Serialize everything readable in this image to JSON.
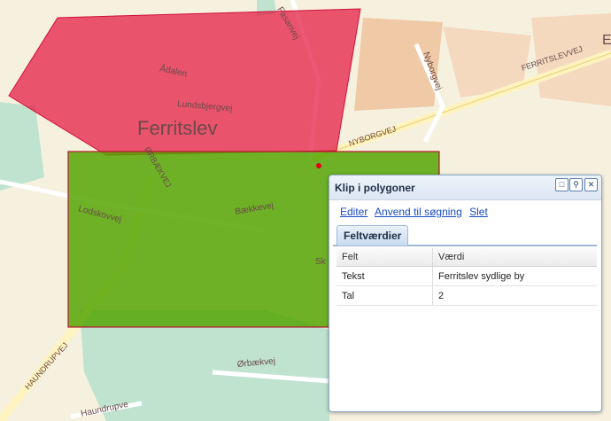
{
  "map": {
    "town_label": "Ferritslev",
    "corner_label": "E",
    "streets": [
      "Ådalen",
      "Lundsbjergvej",
      "Fasanvej",
      "Nyborgvej",
      "FERRITSLEVVEJ",
      "NYBORGVEJ",
      "ØRBÆKVEJ",
      "Lodskovvej",
      "Bækkevej",
      "Ørbækvej",
      "HAUNDRUPVEJ",
      "Haundrupve",
      "Sk"
    ],
    "colors": {
      "red_polygon": "#e3163f",
      "green_polygon": "#52a300",
      "land": "#f6f1df",
      "forest": "#bfe3cf",
      "road": "#fff4bf"
    }
  },
  "popup": {
    "title": "Klip i polygoner",
    "header_buttons": [
      "restore-icon",
      "magnifier-icon",
      "close-icon"
    ],
    "actions": {
      "edit": "Editer",
      "apply": "Anvend til søgning",
      "delete": "Slet"
    },
    "tab": "Feltværdier",
    "table": {
      "columns": [
        "Felt",
        "Værdi"
      ],
      "rows": [
        [
          "Tekst",
          "Ferritslev sydlige by"
        ],
        [
          "Tal",
          "2"
        ]
      ]
    }
  }
}
